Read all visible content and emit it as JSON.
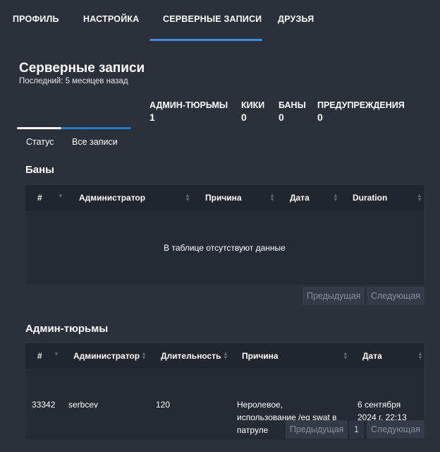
{
  "nav": {
    "items": [
      {
        "label": "ПРОФИЛЬ"
      },
      {
        "label": "НАСТРОЙКА"
      },
      {
        "label": "СЕРВЕРНЫЕ ЗАПИСИ"
      },
      {
        "label": "ДРУЗЬЯ"
      }
    ],
    "active_index": 2
  },
  "header": {
    "title": "Серверные записи",
    "subtitle": "Последний: 5 месяцев назад"
  },
  "stats": [
    {
      "label": "АДМИН-ТЮРЬМЫ",
      "value": "1"
    },
    {
      "label": "КИКИ",
      "value": "0"
    },
    {
      "label": "БАНЫ",
      "value": "0"
    },
    {
      "label": "ПРЕДУПРЕЖДЕНИЯ",
      "value": "0"
    }
  ],
  "subtabs": [
    {
      "label": "Статус"
    },
    {
      "label": "Все записи"
    }
  ],
  "bans": {
    "title": "Баны",
    "columns": [
      "#",
      "Администратор",
      "Причина",
      "Дата",
      "Duration"
    ],
    "empty_text": "В таблице отсутствуют данные",
    "prev_label": "Предыдущая",
    "next_label": "Следующая"
  },
  "jails": {
    "title": "Админ-тюрьмы",
    "columns": [
      "#",
      "Администратор",
      "Длительность",
      "Причина",
      "Дата"
    ],
    "rows": [
      {
        "id": "33342",
        "admin": "serbcev",
        "duration": "120",
        "reason_lines": [
          "Неролевое,",
          "использование /eq swat в",
          "патруле"
        ],
        "date_lines": [
          "6 сентября",
          "2024 г. 22:13"
        ]
      }
    ],
    "prev_label": "Предыдущая",
    "page_label": "1",
    "next_label": "Следующая"
  },
  "colors": {
    "background": "#2b303b",
    "table_bg": "#21252e",
    "accent": "#3b8be5"
  }
}
